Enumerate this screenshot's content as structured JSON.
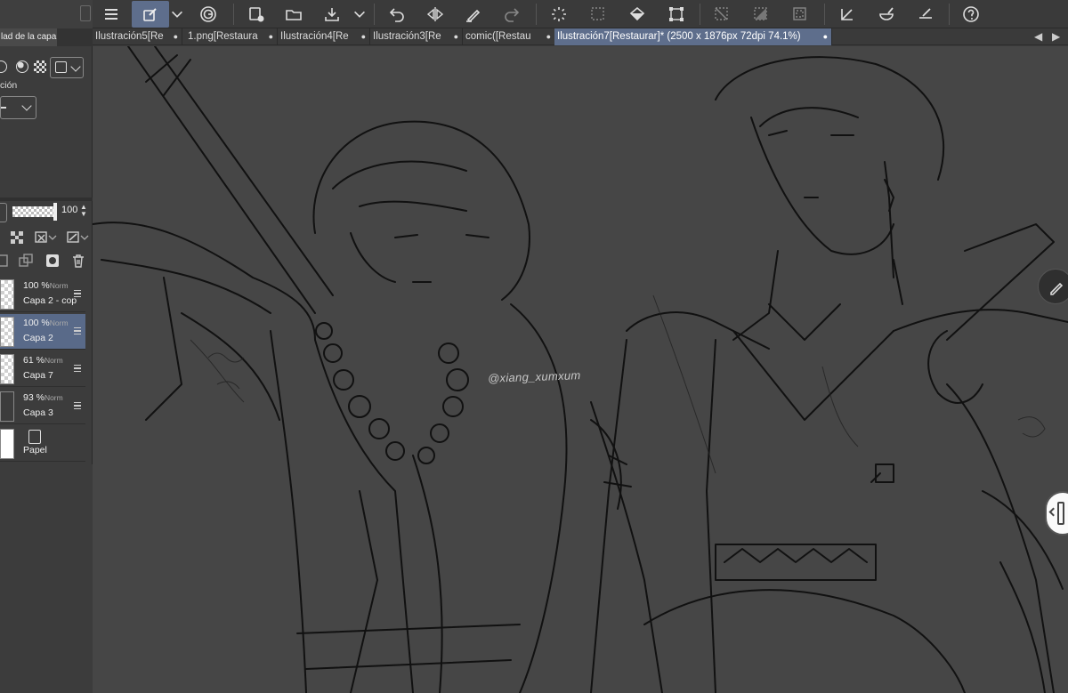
{
  "toolbar": {
    "items": [
      "menu-icon",
      "layer-property-icon",
      "dropdown-chevron-icon",
      "spiral-icon",
      "new-layer-icon",
      "open-folder-icon",
      "save-tray-icon",
      "save-dropdown-icon",
      "undo-icon",
      "flip-horizontal-icon",
      "pen-icon",
      "redo-icon",
      "loading-icon",
      "selection-icon",
      "fill-icon",
      "transform-icon",
      "deselect-icon",
      "invert-selection-icon",
      "selection-frame-icon",
      "ruler-icon",
      "brush-icon",
      "pen-edit-icon",
      "help-icon"
    ]
  },
  "left_panel": {
    "tab_title": "lad de la capa",
    "expression_label": "ción",
    "opacity_value": "100",
    "opacity_percent": 100,
    "layers": [
      {
        "opacity": "100 %",
        "mode": "Norm",
        "name": "Capa 2 - cop",
        "thumb": "transparent",
        "selected": false
      },
      {
        "opacity": "100 %",
        "mode": "Norm",
        "name": "Capa 2",
        "thumb": "transparent",
        "selected": true
      },
      {
        "opacity": "61 %",
        "mode": "Norm",
        "name": "Capa 7",
        "thumb": "transparent",
        "selected": false
      },
      {
        "opacity": "93 %",
        "mode": "Norm",
        "name": "Capa 3",
        "thumb": "gray",
        "selected": false
      },
      {
        "opacity": "",
        "mode": "",
        "name": "Papel",
        "thumb": "white",
        "selected": false
      }
    ]
  },
  "tabs": [
    {
      "label": "Ilustración5[Re",
      "active": false
    },
    {
      "label": "1.png[Restaura",
      "active": false
    },
    {
      "label": "Ilustración4[Re",
      "active": false
    },
    {
      "label": "Ilustración3[Re",
      "active": false
    },
    {
      "label": "comic([Restau",
      "active": false
    },
    {
      "label": "Ilustración7[Restaurar]* (2500 x 1876px 72dpi 74.1%)",
      "active": true
    }
  ],
  "tab_dot": "●",
  "canvas": {
    "watermark": "@xiang_xumxum"
  },
  "colors": {
    "accent": "#5e6e8c",
    "selected_layer": "#596a89",
    "canvas_bg": "#464646",
    "panel_bg": "#3c3c3c"
  }
}
